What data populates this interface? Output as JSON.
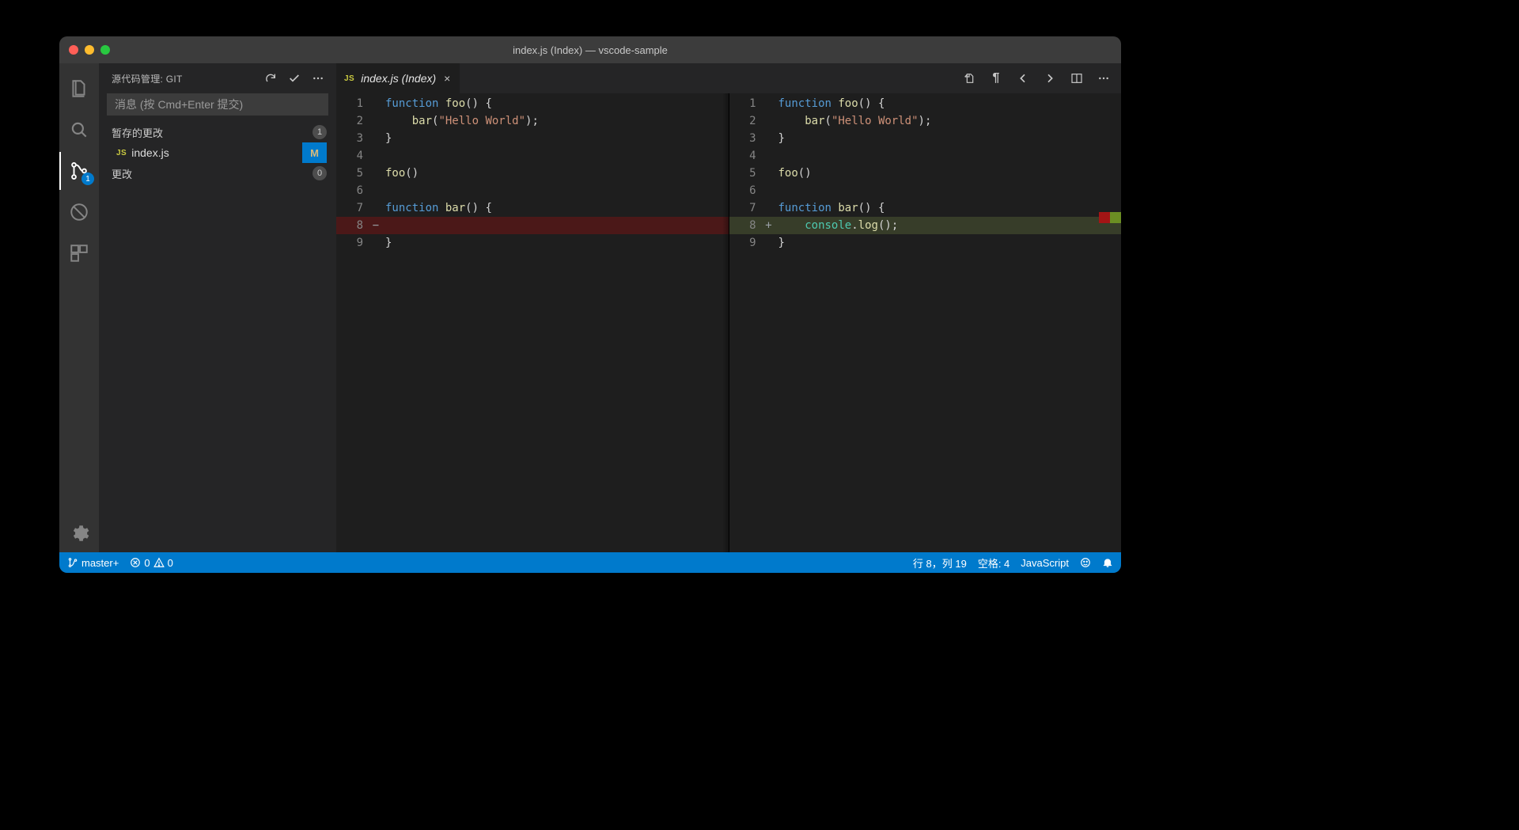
{
  "window": {
    "title": "index.js (Index) — vscode-sample"
  },
  "activity": {
    "scm_badge": "1"
  },
  "sidebar": {
    "header_title": "源代码管理: GIT",
    "input_placeholder": "消息 (按 Cmd+Enter 提交)",
    "staged": {
      "label": "暂存的更改",
      "count": "1"
    },
    "staged_files": [
      {
        "icon": "JS",
        "name": "index.js",
        "status": "M"
      }
    ],
    "changes": {
      "label": "更改",
      "count": "0"
    }
  },
  "tabs": {
    "file_icon": "JS",
    "file_label": "index.js (Index)"
  },
  "status": {
    "branch": "master+",
    "errors": "0",
    "warnings": "0",
    "cursor": "行 8，列 19",
    "spaces": "空格: 4",
    "language": "JavaScript"
  },
  "code": {
    "left": [
      {
        "n": "1",
        "html": "<span class='kw'>function</span> <span class='fn'>foo</span>() {"
      },
      {
        "n": "2",
        "html": "    <span class='fn'>bar</span>(<span class='str'>\"Hello World\"</span>);"
      },
      {
        "n": "3",
        "html": "}"
      },
      {
        "n": "4",
        "html": ""
      },
      {
        "n": "5",
        "html": "<span class='fn'>foo</span>()"
      },
      {
        "n": "6",
        "html": ""
      },
      {
        "n": "7",
        "html": "<span class='kw'>function</span> <span class='fn'>bar</span>() {"
      },
      {
        "n": "8",
        "html": "",
        "mark": "−",
        "cls": "removed"
      },
      {
        "n": "9",
        "html": "}"
      }
    ],
    "right": [
      {
        "n": "1",
        "html": "<span class='kw'>function</span> <span class='fn'>foo</span>() {"
      },
      {
        "n": "2",
        "html": "    <span class='fn'>bar</span>(<span class='str'>\"Hello World\"</span>);"
      },
      {
        "n": "3",
        "html": "}"
      },
      {
        "n": "4",
        "html": ""
      },
      {
        "n": "5",
        "html": "<span class='fn'>foo</span>()"
      },
      {
        "n": "6",
        "html": ""
      },
      {
        "n": "7",
        "html": "<span class='kw'>function</span> <span class='fn'>bar</span>() {"
      },
      {
        "n": "8",
        "html": "    <span class='obj'>console</span>.<span class='fn'>log</span>();",
        "mark": "+",
        "cls": "added"
      },
      {
        "n": "9",
        "html": "}"
      }
    ]
  }
}
